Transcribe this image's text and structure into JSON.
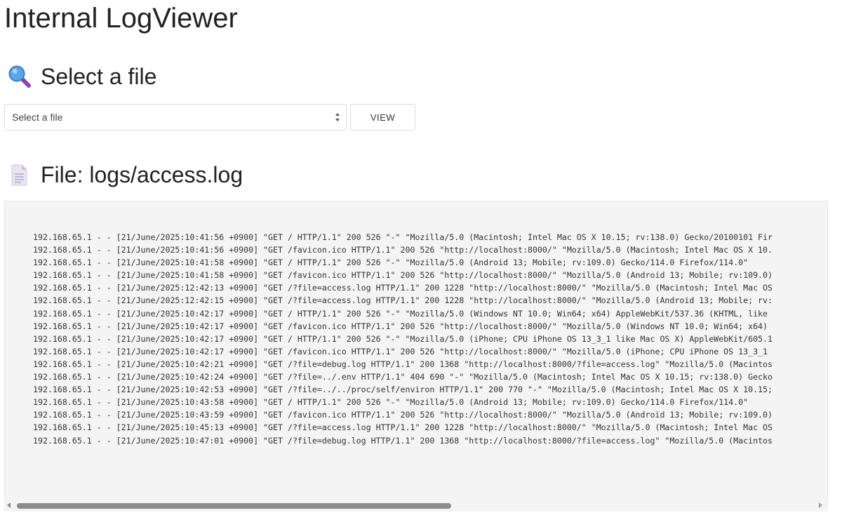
{
  "header": {
    "title": "Internal LogViewer"
  },
  "file_selector": {
    "heading": "Select a file",
    "heading_icon": "magnifier-icon",
    "select_placeholder": "Select a file",
    "view_label": "VIEW"
  },
  "log_view": {
    "heading": "File: logs/access.log",
    "heading_icon": "document-icon",
    "lines": [
      "192.168.65.1 - - [21/June/2025:10:41:56 +0900] \"GET / HTTP/1.1\" 200 526 \"-\" \"Mozilla/5.0 (Macintosh; Intel Mac OS X 10.15; rv:138.0) Gecko/20100101 Fir",
      "192.168.65.1 - - [21/June/2025:10:41:56 +0900] \"GET /favicon.ico HTTP/1.1\" 200 526 \"http://localhost:8000/\" \"Mozilla/5.0 (Macintosh; Intel Mac OS X 10.",
      "192.168.65.1 - - [21/June/2025:10:41:58 +0900] \"GET / HTTP/1.1\" 200 526 \"-\" \"Mozilla/5.0 (Android 13; Mobile; rv:109.0) Gecko/114.0 Firefox/114.0\"",
      "192.168.65.1 - - [21/June/2025:10:41:58 +0900] \"GET /favicon.ico HTTP/1.1\" 200 526 \"http://localhost:8000/\" \"Mozilla/5.0 (Android 13; Mobile; rv:109.0)",
      "192.168.65.1 - - [21/June/2025:12:42:13 +0900] \"GET /?file=access.log HTTP/1.1\" 200 1228 \"http://localhost:8000/\" \"Mozilla/5.0 (Macintosh; Intel Mac OS",
      "192.168.65.1 - - [21/June/2025:12:42:15 +0900] \"GET /?file=access.log HTTP/1.1\" 200 1228 \"http://localhost:8000/\" \"Mozilla/5.0 (Android 13; Mobile; rv:",
      "192.168.65.1 - - [21/June/2025:10:42:17 +0900] \"GET / HTTP/1.1\" 200 526 \"-\" \"Mozilla/5.0 (Windows NT 10.0; Win64; x64) AppleWebKit/537.36 (KHTML, like",
      "192.168.65.1 - - [21/June/2025:10:42:17 +0900] \"GET /favicon.ico HTTP/1.1\" 200 526 \"http://localhost:8000/\" \"Mozilla/5.0 (Windows NT 10.0; Win64; x64)",
      "192.168.65.1 - - [21/June/2025:10:42:17 +0900] \"GET / HTTP/1.1\" 200 526 \"-\" \"Mozilla/5.0 (iPhone; CPU iPhone OS 13_3_1 like Mac OS X) AppleWebKit/605.1",
      "192.168.65.1 - - [21/June/2025:10:42:17 +0900] \"GET /favicon.ico HTTP/1.1\" 200 526 \"http://localhost:8000/\" \"Mozilla/5.0 (iPhone; CPU iPhone OS 13_3_1",
      "192.168.65.1 - - [21/June/2025:10:42:21 +0900] \"GET /?file=debug.log HTTP/1.1\" 200 1368 \"http://localhost:8000/?file=access.log\" \"Mozilla/5.0 (Macintos",
      "192.168.65.1 - - [21/June/2025:10:42:24 +0900] \"GET /?file=../.env HTTP/1.1\" 404 690 \"-\" \"Mozilla/5.0 (Macintosh; Intel Mac OS X 10.15; rv:138.0) Gecko",
      "192.168.65.1 - - [21/June/2025:10:42:53 +0900] \"GET /?file=../../proc/self/environ HTTP/1.1\" 200 770 \"-\" \"Mozilla/5.0 (Macintosh; Intel Mac OS X 10.15;",
      "192.168.65.1 - - [21/June/2025:10:43:58 +0900] \"GET / HTTP/1.1\" 200 526 \"-\" \"Mozilla/5.0 (Android 13; Mobile; rv:109.0) Gecko/114.0 Firefox/114.0\"",
      "192.168.65.1 - - [21/June/2025:10:43:59 +0900] \"GET /favicon.ico HTTP/1.1\" 200 526 \"http://localhost:8000/\" \"Mozilla/5.0 (Android 13; Mobile; rv:109.0)",
      "192.168.65.1 - - [21/June/2025:10:45:13 +0900] \"GET /?file=access.log HTTP/1.1\" 200 1228 \"http://localhost:8000/\" \"Mozilla/5.0 (Macintosh; Intel Mac OS",
      "192.168.65.1 - - [21/June/2025:10:47:01 +0900] \"GET /?file=debug.log HTTP/1.1\" 200 1368 \"http://localhost:8000/?file=access.log\" \"Mozilla/5.0 (Macintos"
    ]
  },
  "scrollbar": {
    "horizontal_position": 0,
    "visible_fraction": 0.54
  },
  "colors": {
    "text": "#222222",
    "panel_bg": "#f4f4f4",
    "border": "#dcdcdc",
    "magnifier_glass": "#4a90d9",
    "magnifier_handle": "#8e44ad",
    "document_page": "#e6dff0"
  }
}
